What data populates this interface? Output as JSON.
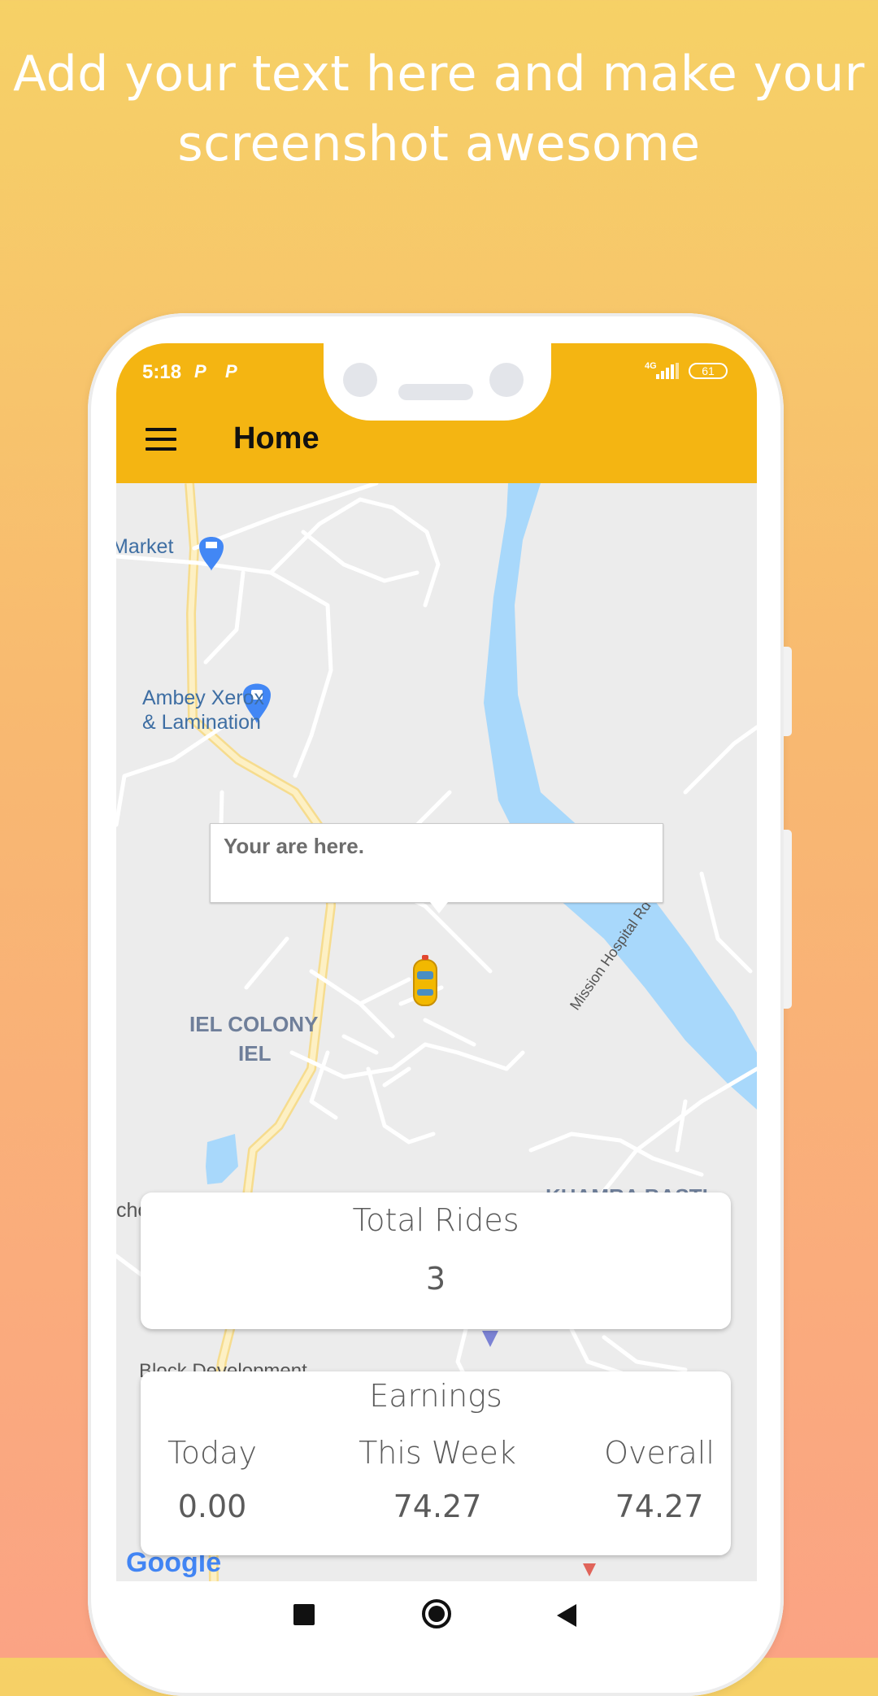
{
  "promo": {
    "headline_line1": "Add your text here and make your",
    "headline_line2": "screenshot awesome"
  },
  "status_bar": {
    "time": "5:18",
    "notification_icons": [
      "P",
      "P"
    ],
    "network": "4G",
    "battery": "61"
  },
  "app_bar": {
    "title": "Home",
    "menu_icon": "menu-icon"
  },
  "map": {
    "labels": {
      "market": "Market",
      "ambey_line1": "Ambey Xerox",
      "ambey_line2": "& Lamination",
      "iel_colony_line1": "IEL COLONY",
      "iel_colony_line2": "IEL",
      "khamra_basti": "KHAMRA BASTI",
      "mission_hospital_rd": "Mission Hospital Rd",
      "block_development": "Block Development",
      "school_partial": "chool"
    },
    "callout": "Your are here.",
    "google_logo": "Google"
  },
  "total_rides": {
    "label": "Total Rides",
    "value": "3"
  },
  "earnings": {
    "title": "Earnings",
    "today_label": "Today",
    "today_value": "0.00",
    "week_label": "This Week",
    "week_value": "74.27",
    "overall_label": "Overall",
    "overall_value": "74.27"
  },
  "colors": {
    "accent": "#f4b512",
    "river": "#a8d8fb",
    "map_bg": "#ececec"
  }
}
